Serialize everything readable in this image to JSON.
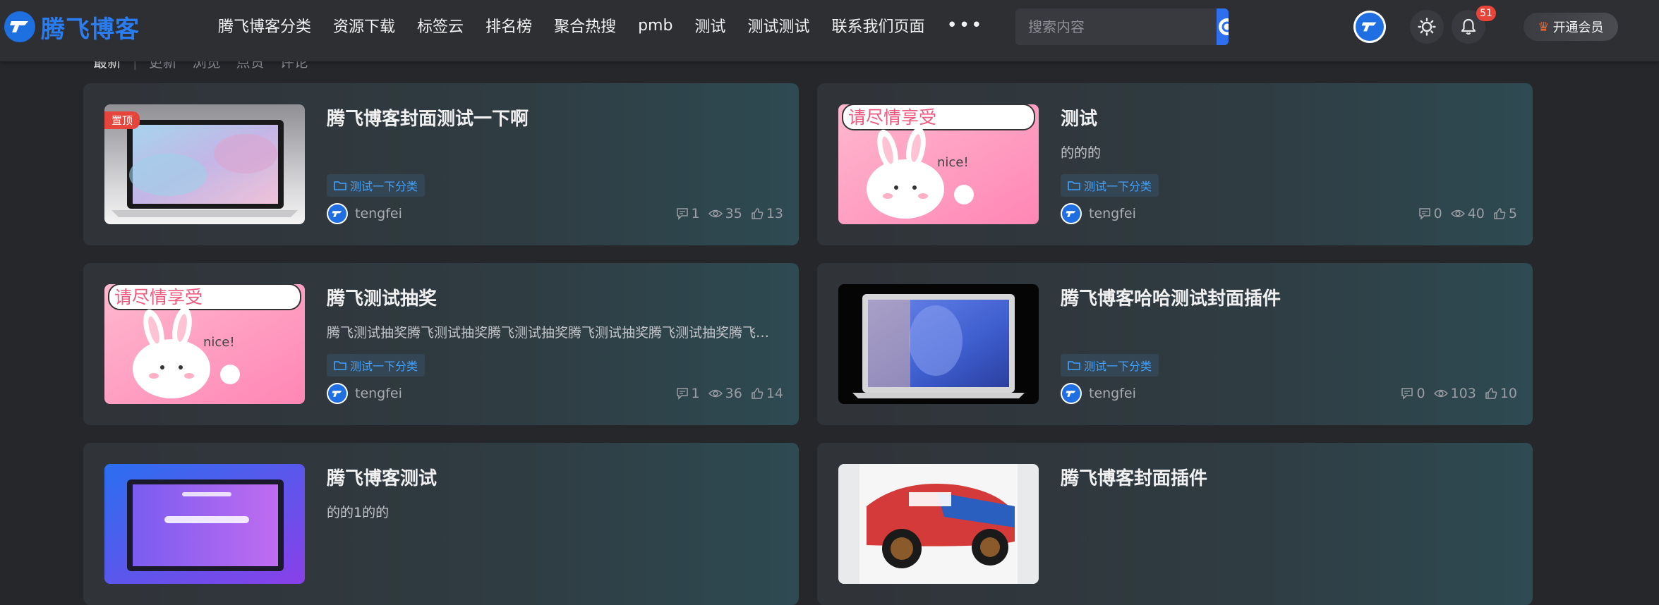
{
  "site": {
    "logo_text": "腾飞博客"
  },
  "nav": {
    "items": [
      "腾飞博客分类",
      "资源下载",
      "标签云",
      "排名榜",
      "聚合热搜",
      "pmb",
      "测试",
      "测试测试",
      "联系我们页面"
    ],
    "more": "•••"
  },
  "search": {
    "placeholder": "搜索内容"
  },
  "header": {
    "notification_count": "51",
    "vip_label": "开通会员"
  },
  "sortbar": {
    "active": "最新",
    "options": [
      "更新",
      "浏览",
      "点赞",
      "评论"
    ]
  },
  "colors": {
    "accent": "#2e6ff0",
    "category_text": "#3fa2ff",
    "pin_badge": "#e5453b",
    "notification_badge": "#e8443a"
  },
  "posts": [
    {
      "title": "腾飞博客封面测试一下啊",
      "excerpt": "",
      "category": "测试一下分类",
      "author": "tengfei",
      "comments": "1",
      "views": "35",
      "likes": "13",
      "pinned": true,
      "pin_label": "置顶",
      "cover": "laptop-pastel"
    },
    {
      "title": "测试",
      "excerpt": "的的的",
      "category": "测试一下分类",
      "author": "tengfei",
      "comments": "0",
      "views": "40",
      "likes": "5",
      "pinned": false,
      "cover": "bunny",
      "cover_text": "请尽情享受",
      "cover_sub": "nice!"
    },
    {
      "title": "腾飞测试抽奖",
      "excerpt": "腾飞测试抽奖腾飞测试抽奖腾飞测试抽奖腾飞测试抽奖腾飞测试抽奖腾飞测试抽奖",
      "category": "测试一下分类",
      "author": "tengfei",
      "comments": "1",
      "views": "36",
      "likes": "14",
      "pinned": false,
      "cover": "bunny",
      "cover_text": "请尽情享受",
      "cover_sub": "nice!"
    },
    {
      "title": "腾飞博客哈哈测试封面插件",
      "excerpt": "",
      "category": "测试一下分类",
      "author": "tengfei",
      "comments": "0",
      "views": "103",
      "likes": "10",
      "pinned": false,
      "cover": "laptop-portrait"
    },
    {
      "title": "腾飞博客测试",
      "excerpt": "的的1的的",
      "category": "",
      "author": "",
      "comments": "",
      "views": "",
      "likes": "",
      "pinned": false,
      "cover": "laptop-purple"
    },
    {
      "title": "腾飞博客封面插件",
      "excerpt": "",
      "category": "",
      "author": "",
      "comments": "",
      "views": "",
      "likes": "",
      "pinned": false,
      "cover": "race-car"
    }
  ]
}
